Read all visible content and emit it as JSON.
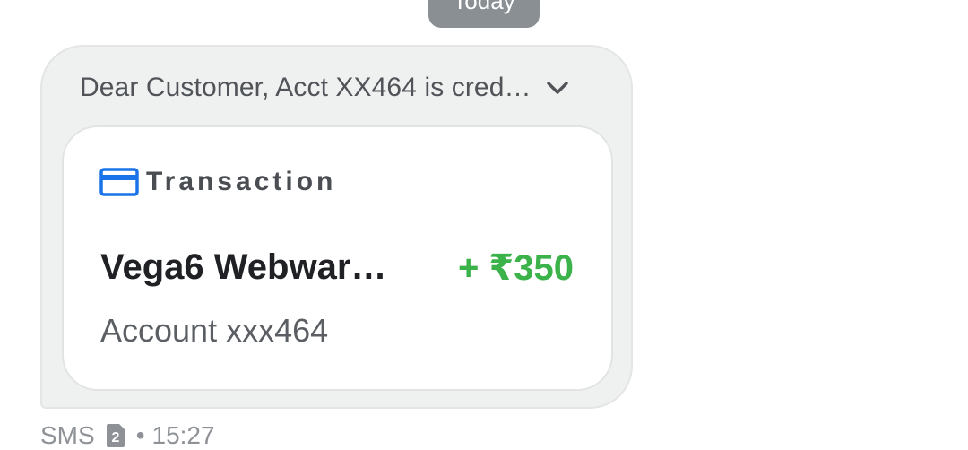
{
  "date_chip": {
    "label": "Today"
  },
  "message": {
    "preview": "Dear Customer, Acct XX464 is cred…",
    "expand_icon": "chevron-down-icon",
    "card": {
      "icon": "credit-card-icon",
      "icon_color": "#1a73e8",
      "label": "Transaction",
      "merchant": "Vega6 Webwar…",
      "amount": "+ ₹350",
      "amount_color": "#3bb24a",
      "account": "Account xxx464"
    }
  },
  "meta": {
    "channel": "SMS",
    "sim_icon": "sim-2-icon",
    "separator": "•",
    "time": "15:27"
  }
}
